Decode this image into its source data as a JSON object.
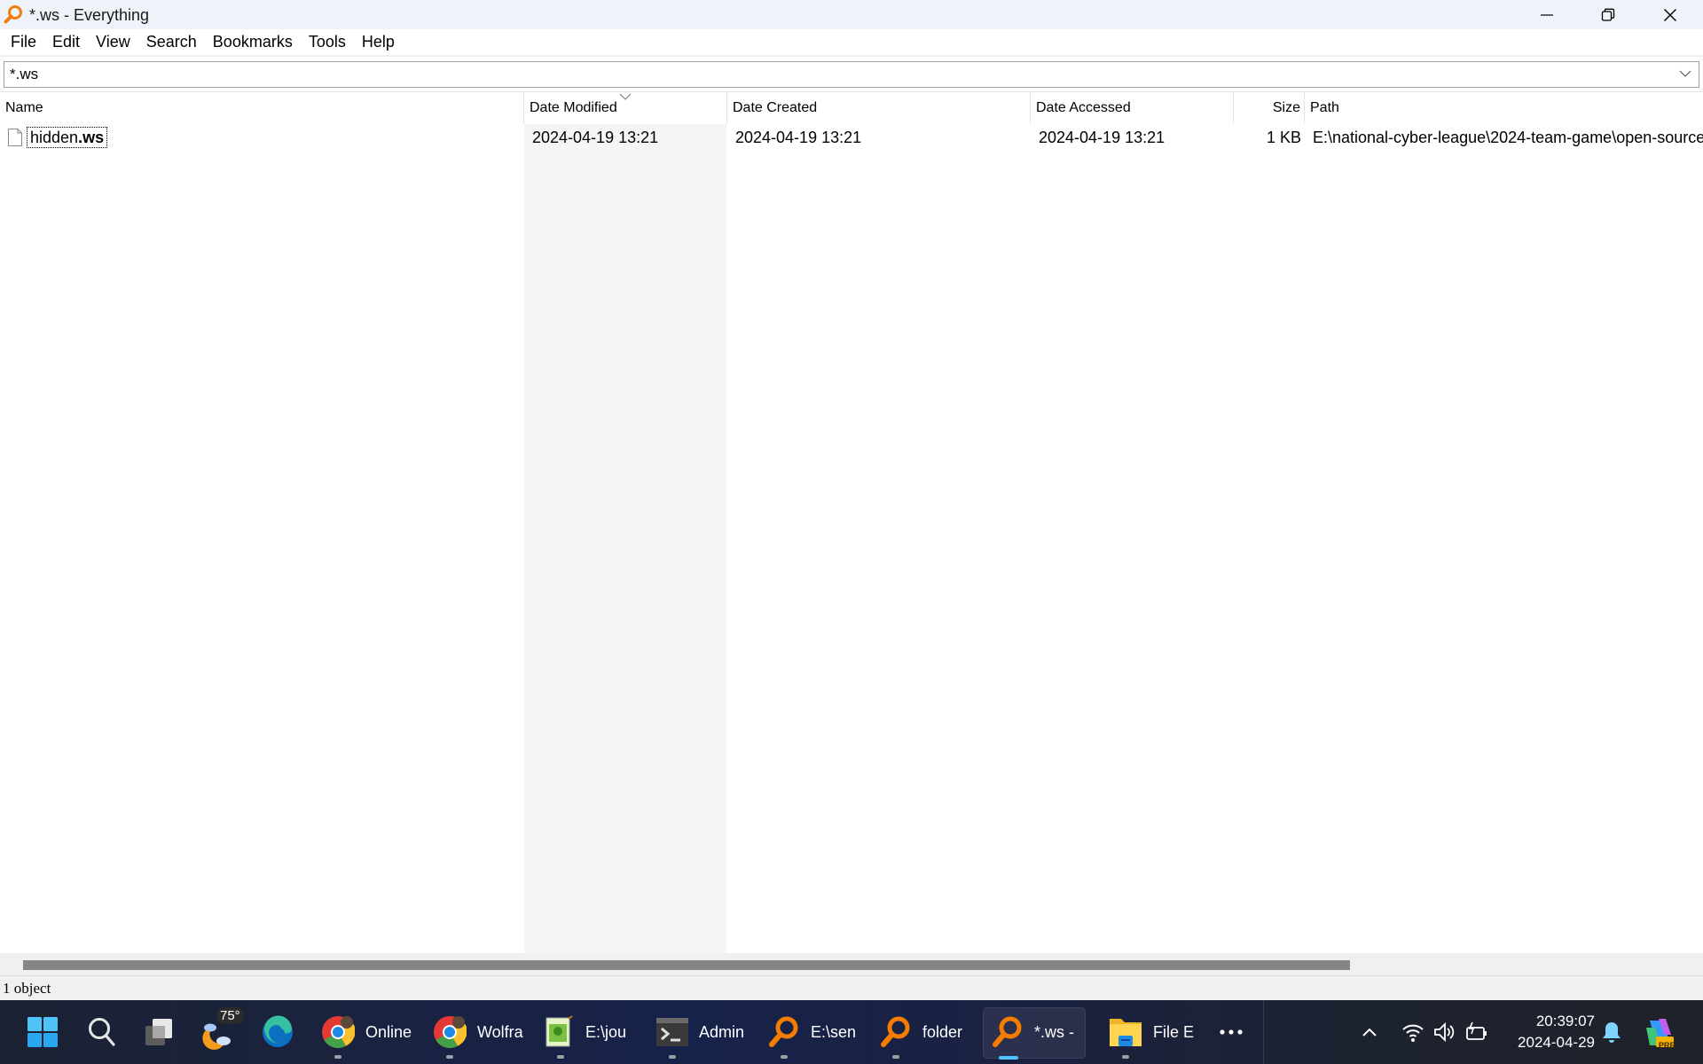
{
  "window": {
    "title": "*.ws - Everything",
    "app_icon": "everything-magnifier-icon",
    "controls": {
      "minimize": "minimize-icon",
      "restore": "restore-icon",
      "close": "close-icon"
    }
  },
  "menu": [
    "File",
    "Edit",
    "View",
    "Search",
    "Bookmarks",
    "Tools",
    "Help"
  ],
  "search": {
    "value": "*.ws",
    "placeholder": ""
  },
  "columns": [
    {
      "key": "name",
      "label": "Name"
    },
    {
      "key": "date_modified",
      "label": "Date Modified",
      "sorted": "descending"
    },
    {
      "key": "date_created",
      "label": "Date Created"
    },
    {
      "key": "date_accessed",
      "label": "Date Accessed"
    },
    {
      "key": "size",
      "label": "Size"
    },
    {
      "key": "path",
      "label": "Path"
    }
  ],
  "rows": [
    {
      "name_base": "hidden",
      "name_ext": ".ws",
      "date_modified": "2024-04-19 13:21",
      "date_created": "2024-04-19 13:21",
      "date_accessed": "2024-04-19 13:21",
      "size": "1 KB",
      "path": "E:\\national-cyber-league\\2024-team-game\\open-source"
    }
  ],
  "status": {
    "text": "1 object"
  },
  "taskbar": {
    "weather": {
      "temp": "75°"
    },
    "apps": [
      {
        "icon": "chrome-icon",
        "label": "Online"
      },
      {
        "icon": "chrome-icon",
        "label": "Wolfra"
      },
      {
        "icon": "notepad-plus-plus-icon",
        "label": "E:\\jou"
      },
      {
        "icon": "terminal-icon",
        "label": "Admin"
      },
      {
        "icon": "everything-magnifier-icon",
        "label": "E:\\sen"
      },
      {
        "icon": "everything-magnifier-icon",
        "label": "folder"
      },
      {
        "icon": "everything-magnifier-icon",
        "label": "*.ws -",
        "active": true
      },
      {
        "icon": "file-explorer-icon",
        "label": "File E"
      }
    ],
    "clock": {
      "time": "20:39:07",
      "date": "2024-04-29"
    },
    "copilot_badge": "PRE"
  }
}
